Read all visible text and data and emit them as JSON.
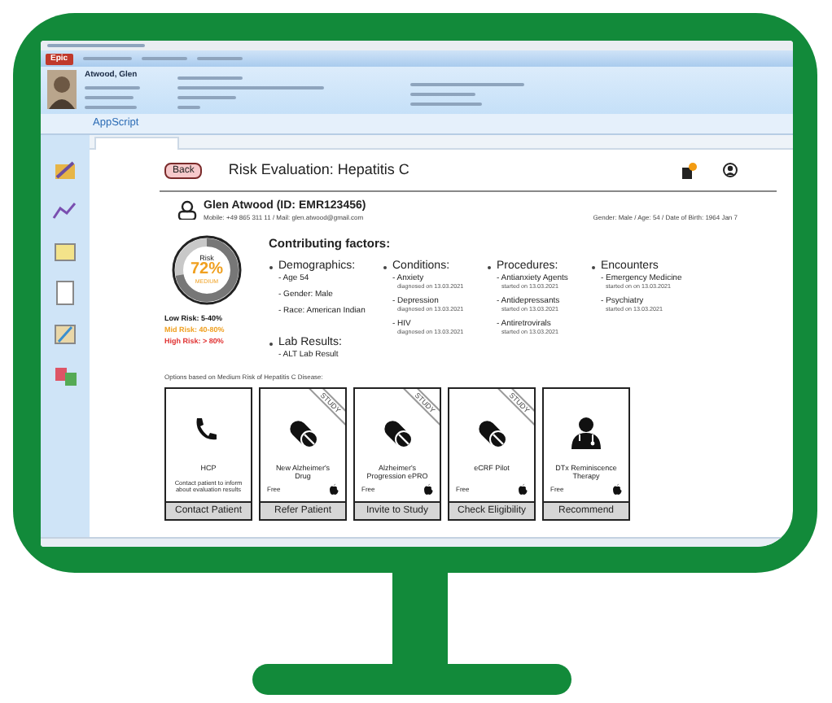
{
  "toolbar": {
    "menu": "Epic"
  },
  "patient_header": {
    "name": "Atwood, Glen"
  },
  "activity_bar": {
    "title": "AppScript"
  },
  "page": {
    "back": "Back",
    "title": "Risk Evaluation: Hepatitis C"
  },
  "patient": {
    "name": "Glen Atwood (ID: EMR123456)",
    "contact": "Mobile: +49 865 311 11 / Mail: glen.atwood@gmail.com",
    "details": "Gender: Male / Age: 54 / Date of Birth: 1964 Jan 7"
  },
  "risk": {
    "label": "Risk",
    "value": "72%",
    "band": "MEDIUM",
    "level": 0.72,
    "legend": [
      {
        "text": "Low Risk: 5-40%",
        "color": "#111111"
      },
      {
        "text": "Mid Risk: 40-80%",
        "color": "#f0a020"
      },
      {
        "text": "High Risk: > 80%",
        "color": "#e03030"
      }
    ]
  },
  "factors": {
    "title": "Contributing factors:",
    "columns": [
      [
        {
          "heading": "Demographics:",
          "items": [
            {
              "text": "- Age 54"
            },
            {
              "text": "- Gender: Male"
            },
            {
              "text": "- Race: American Indian"
            }
          ]
        },
        {
          "heading": "Lab Results:",
          "items": [
            {
              "text": "- ALT Lab Result"
            }
          ]
        }
      ],
      [
        {
          "heading": "Conditions:",
          "items": [
            {
              "text": "- Anxiety",
              "note": "diagnosed on 13.03.2021"
            },
            {
              "text": "- Depression",
              "note": "diagnosed on 13.03.2021"
            },
            {
              "text": "- HIV",
              "note": "diagnosed on 13.03.2021"
            }
          ]
        }
      ],
      [
        {
          "heading": "Procedures:",
          "items": [
            {
              "text": "- Antianxiety Agents",
              "note": "started on 13.03.2021"
            },
            {
              "text": "- Antidepressants",
              "note": "started on 13.03.2021"
            },
            {
              "text": "- Antiretrovirals",
              "note": "started on 13.03.2021"
            }
          ]
        }
      ],
      [
        {
          "heading": "Encounters",
          "items": [
            {
              "text": "- Emergency Medicine",
              "note": "started on on 13.03.2021"
            },
            {
              "text": "- Psychiatry",
              "note": "started on 13.03.2021"
            }
          ]
        }
      ]
    ]
  },
  "options": {
    "intro": "Options based on Medium Risk of Hepatitis C Disease:",
    "cards": [
      {
        "kind": "phone",
        "title": "HCP",
        "description": "Contact patient to inform about evaluation results",
        "action": "Contact Patient"
      },
      {
        "kind": "pill",
        "ribbon": "STUDY",
        "title": "New Alzheimer's Drug",
        "price": "Free",
        "action": "Refer Patient"
      },
      {
        "kind": "pill",
        "ribbon": "STUDY",
        "title": "Alzheimer's Progression ePRO",
        "price": "Free",
        "action": "Invite to Study"
      },
      {
        "kind": "pill",
        "ribbon": "STUDY",
        "title": "eCRF Pilot",
        "price": "Free",
        "action": "Check Eligibility"
      },
      {
        "kind": "doctor",
        "title": "DTx Reminiscence Therapy",
        "price": "Free",
        "action": "Recommend"
      }
    ]
  }
}
